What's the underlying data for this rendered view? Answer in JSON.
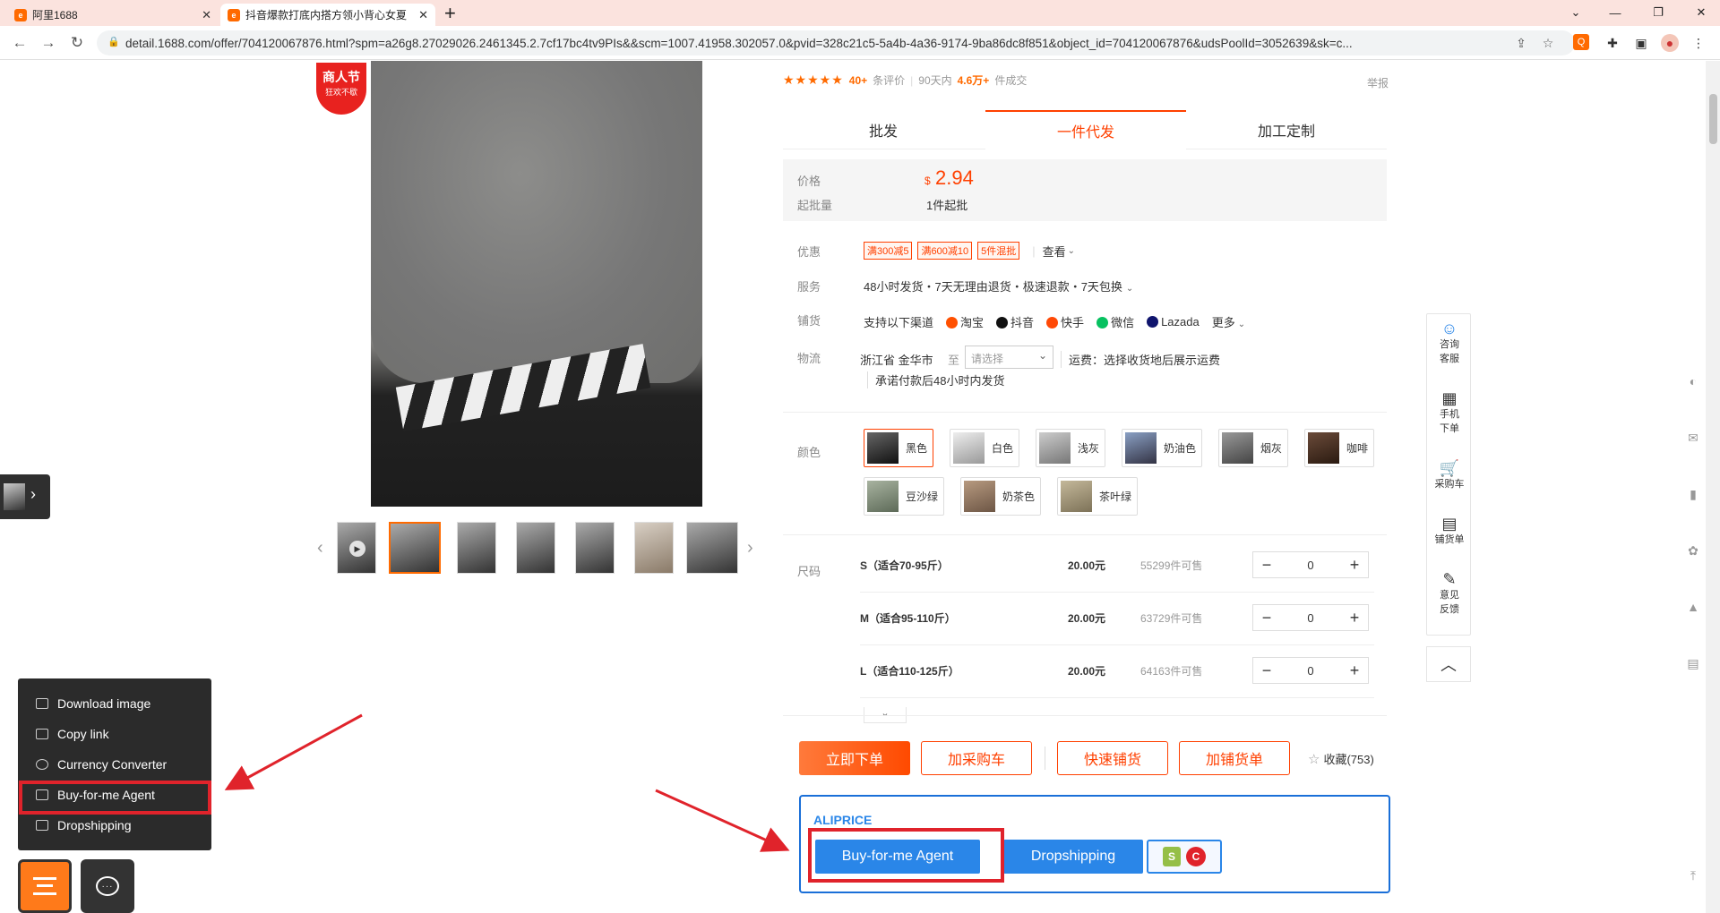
{
  "browser": {
    "tabs": [
      {
        "label": "阿里1688",
        "favicon": "1688-logo-icon"
      },
      {
        "label": "抖音爆款打底内搭方领小背心女夏",
        "favicon": "1688-logo-icon"
      }
    ],
    "new_tab": "+",
    "url": "detail.1688.com/offer/704120067876.html?spm=a26g8.27029026.2461345.2.7cf17bc4tv9PIs&&scm=1007.41958.302057.0&pvid=328c21c5-5a4b-4a36-9174-9ba86dc8f851&object_id=704120067876&udsPoolId=3052639&sk=c..."
  },
  "product": {
    "badge_line1": "商人节",
    "badge_line2": "狂欢不歇",
    "rating_count": "40+",
    "rating_label": "条评价",
    "sales_prefix": "90天内",
    "sales_value": "4.6万+",
    "sales_label": "件成交",
    "report": "举报",
    "tabs": [
      "批发",
      "一件代发",
      "加工定制"
    ],
    "price_label": "价格",
    "currency": "$",
    "price": "2.94",
    "moq_label": "起批量",
    "moq_value": "1件起批",
    "discount_label": "优惠",
    "coupons": [
      "满300减5",
      "满600减10",
      "5件混批"
    ],
    "view_more": "查看",
    "service_label": "服务",
    "service_text": "48小时发货・7天无理由退货・极速退款・7天包换",
    "dropship_label": "铺货",
    "channels_intro": "支持以下渠道",
    "channels": [
      {
        "name": "淘宝",
        "color": "#ff5000"
      },
      {
        "name": "抖音",
        "color": "#111111"
      },
      {
        "name": "快手",
        "color": "#ff4906"
      },
      {
        "name": "微信",
        "color": "#07c160"
      },
      {
        "name": "Lazada",
        "color": "#0f146d"
      }
    ],
    "channels_more": "更多",
    "logistics_label": "物流",
    "origin": "浙江省 金华市",
    "to": "至",
    "dest_placeholder": "请选择",
    "shipping_text": "运费：选择收货地后展示运费",
    "ship_promise": "承诺付款后48小时内发货",
    "color_label": "颜色",
    "colors": [
      "黑色",
      "白色",
      "浅灰",
      "奶油色",
      "烟灰",
      "咖啡",
      "豆沙绿",
      "奶茶色",
      "茶叶绿"
    ],
    "size_label": "尺码",
    "sizes": [
      {
        "name": "S（适合70-95斤）",
        "price": "20.00元",
        "stock": "55299件可售",
        "qty": "0"
      },
      {
        "name": "M（适合95-110斤）",
        "price": "20.00元",
        "stock": "63729件可售",
        "qty": "0"
      },
      {
        "name": "L（适合110-125斤）",
        "price": "20.00元",
        "stock": "64163件可售",
        "qty": "0"
      }
    ],
    "actions": [
      "立即下单",
      "加采购车",
      "快速铺货",
      "加铺货单"
    ],
    "favorite": "收藏(753)"
  },
  "aliprice": {
    "brand": "ALIPRICE",
    "buy_agent": "Buy-for-me Agent",
    "dropshipping": "Dropshipping"
  },
  "float_menu": [
    {
      "icon": "chat-smile-icon",
      "label": "咨询客服"
    },
    {
      "icon": "qrcode-icon",
      "label": "手机下单"
    },
    {
      "icon": "cart-icon",
      "label": "采购车"
    },
    {
      "icon": "document-icon",
      "label": "铺货单"
    },
    {
      "icon": "edit-icon",
      "label": "意见反馈"
    }
  ],
  "left_menu": [
    {
      "icon": "image-icon",
      "label": "Download image"
    },
    {
      "icon": "copy-icon",
      "label": "Copy link"
    },
    {
      "icon": "currency-icon",
      "label": "Currency Converter"
    },
    {
      "icon": "cart-icon",
      "label": "Buy-for-me Agent"
    },
    {
      "icon": "box-icon",
      "label": "Dropshipping"
    }
  ],
  "colors": {
    "accent": "#ff4000",
    "aliprice_blue": "#2a86e8",
    "highlight_red": "#e0232b",
    "tab_bg": "#fbe3de"
  }
}
